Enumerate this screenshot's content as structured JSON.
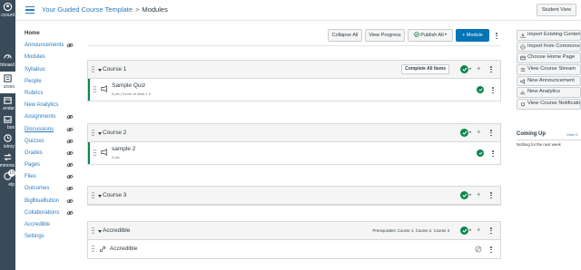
{
  "global_nav": {
    "items": [
      {
        "label": "ccount",
        "icon": "account-icon",
        "active": false
      },
      {
        "label": "shboard",
        "icon": "dashboard-icon",
        "active": false
      },
      {
        "label": "urses",
        "icon": "courses-icon",
        "active": true
      },
      {
        "label": "endar",
        "icon": "calendar-icon",
        "active": false
      },
      {
        "label": "box",
        "icon": "inbox-icon",
        "active": false
      },
      {
        "label": "istory",
        "icon": "history-icon",
        "active": false
      },
      {
        "label": "mmons",
        "icon": "commons-icon",
        "active": false
      },
      {
        "label": "elp",
        "icon": "help-icon",
        "active": false,
        "badge": "10"
      }
    ]
  },
  "header": {
    "course_link": "Your Guided Course Template",
    "separator": ">",
    "current": "Modules",
    "student_view": "Student View"
  },
  "course_nav": {
    "items": [
      {
        "label": "Home",
        "active": true,
        "hidden_icon": false
      },
      {
        "label": "Announcements",
        "hidden_icon": true
      },
      {
        "label": "Modules",
        "hidden_icon": false
      },
      {
        "label": "Syllabus",
        "hidden_icon": false
      },
      {
        "label": "People",
        "hidden_icon": false
      },
      {
        "label": "Rubrics",
        "hidden_icon": false
      },
      {
        "label": "New Analytics",
        "hidden_icon": false
      },
      {
        "label": "Assignments",
        "hidden_icon": true
      },
      {
        "label": "Discussions",
        "hidden_icon": true
      },
      {
        "label": "Quizzes",
        "hidden_icon": true
      },
      {
        "label": "Grades",
        "hidden_icon": true
      },
      {
        "label": "Pages",
        "hidden_icon": true
      },
      {
        "label": "Files",
        "hidden_icon": true
      },
      {
        "label": "Outcomes",
        "hidden_icon": true
      },
      {
        "label": "BigBlueButton",
        "hidden_icon": true
      },
      {
        "label": "Collaborations",
        "hidden_icon": true
      },
      {
        "label": "Accredible",
        "hidden_icon": false
      },
      {
        "label": "Settings",
        "hidden_icon": false
      }
    ]
  },
  "toolbar": {
    "collapse_all": "Collapse All",
    "view_progress": "View Progress",
    "publish_all": "Publish All",
    "add_module": "+ Module"
  },
  "modules": [
    {
      "title": "Course 1",
      "requirement": "Complete All Items",
      "prerequisites": "",
      "items": [
        {
          "title": "Sample Quiz",
          "meta": "5 pts  |  Score at least 1.0",
          "type": "quiz",
          "published": true
        }
      ]
    },
    {
      "title": "Course 2",
      "requirement": "",
      "prerequisites": "",
      "items": [
        {
          "title": "sample 2",
          "meta": "0 pts",
          "type": "quiz",
          "published": true
        }
      ]
    },
    {
      "title": "Course 3",
      "requirement": "",
      "prerequisites": "",
      "items": []
    },
    {
      "title": "Accredible",
      "requirement": "",
      "prerequisites": "Prerequisites: Course 1, Course 2, Course 3",
      "items": [
        {
          "title": "Accredible",
          "meta": "",
          "type": "link",
          "published": false
        }
      ]
    }
  ],
  "sidebar": {
    "buttons": [
      {
        "label": "Import Existing Content",
        "icon": "import-icon"
      },
      {
        "label": "Import from Commons",
        "icon": "commons-import-icon"
      },
      {
        "label": "Choose Home Page",
        "icon": "home-page-icon"
      },
      {
        "label": "View Course Stream",
        "icon": "stream-icon"
      },
      {
        "label": "New Announcement",
        "icon": "announcement-icon"
      },
      {
        "label": "New Analytics",
        "icon": "analytics-icon"
      },
      {
        "label": "View Course Notifications",
        "icon": "bell-icon"
      }
    ],
    "coming_up": {
      "title": "Coming Up",
      "view_link": "View C",
      "empty": "Nothing for the next week"
    }
  },
  "colors": {
    "brand": "#0374b5",
    "published": "#0b874b",
    "nav_bg": "#394b58",
    "link": "#2b7abc"
  }
}
